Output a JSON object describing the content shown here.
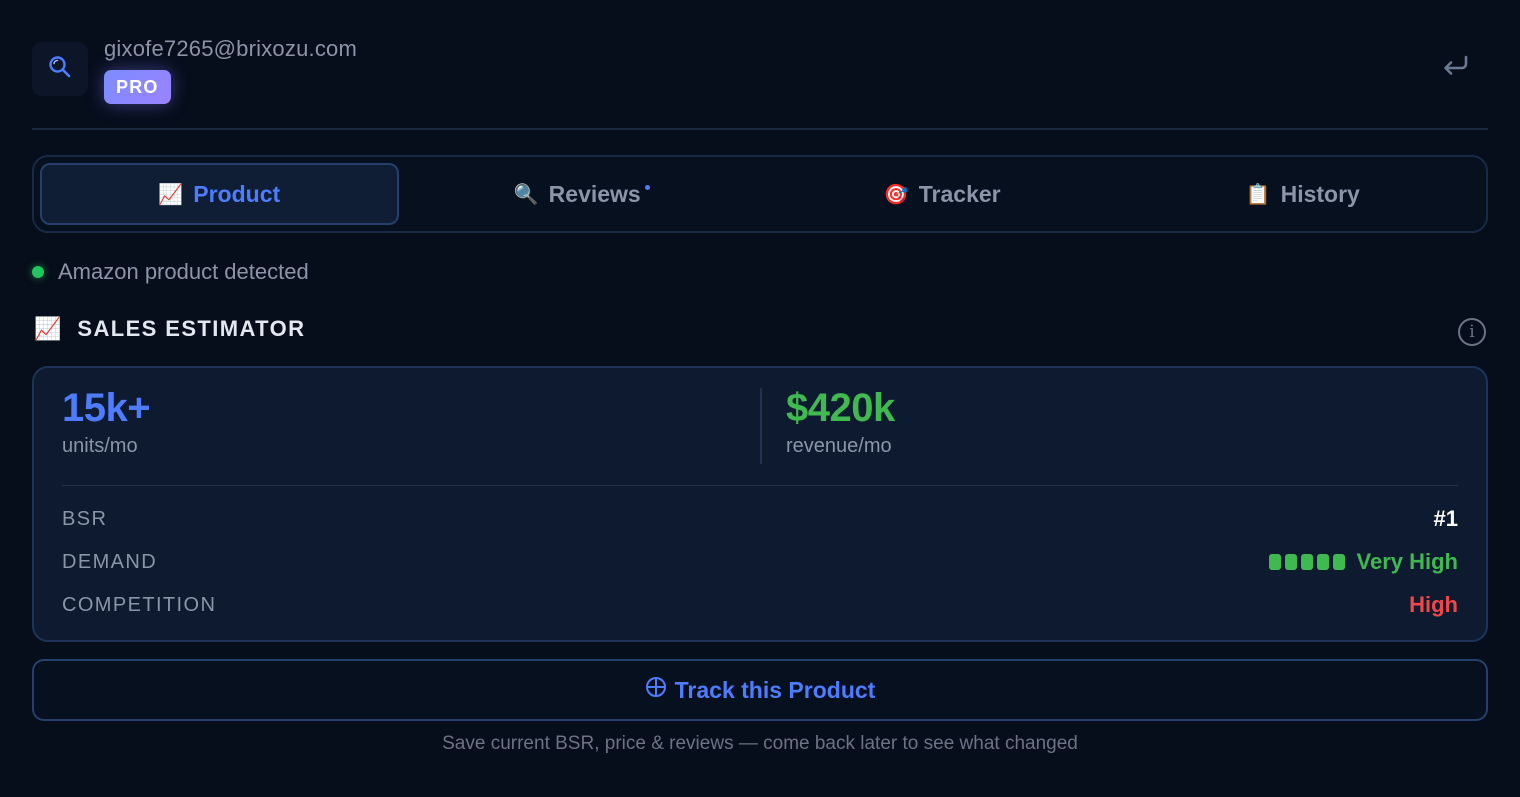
{
  "header": {
    "email": "gixofe7265@brixozu.com",
    "badge": "PRO"
  },
  "tabs": [
    {
      "icon": "📈",
      "label": "Product",
      "active": true
    },
    {
      "icon": "🔍",
      "label": "Reviews",
      "active": false,
      "has_dot": true
    },
    {
      "icon": "🎯",
      "label": "Tracker",
      "active": false
    },
    {
      "icon": "📋",
      "label": "History",
      "active": false
    }
  ],
  "status": {
    "text": "Amazon product detected",
    "color": "#22c55e"
  },
  "section": {
    "icon": "📈",
    "title": "SALES ESTIMATOR",
    "info_symbol": "i"
  },
  "metrics": {
    "units_value": "15k+",
    "units_label": "units/mo",
    "revenue_value": "$420k",
    "revenue_label": "revenue/mo"
  },
  "details": {
    "bsr_label": "BSR",
    "bsr_value": "#1",
    "demand_label": "DEMAND",
    "demand_value": "Very High",
    "demand_level": 5,
    "demand_max": 5,
    "competition_label": "COMPETITION",
    "competition_value": "High"
  },
  "track": {
    "label": "Track this Product",
    "hint": "Save current BSR, price & reviews — come back later to see what changed"
  },
  "colors": {
    "accent": "#4f7cff",
    "positive": "#3fb950",
    "negative": "#f04848",
    "badge_gradient_start": "#7c8cff",
    "badge_gradient_end": "#9a82ff"
  }
}
